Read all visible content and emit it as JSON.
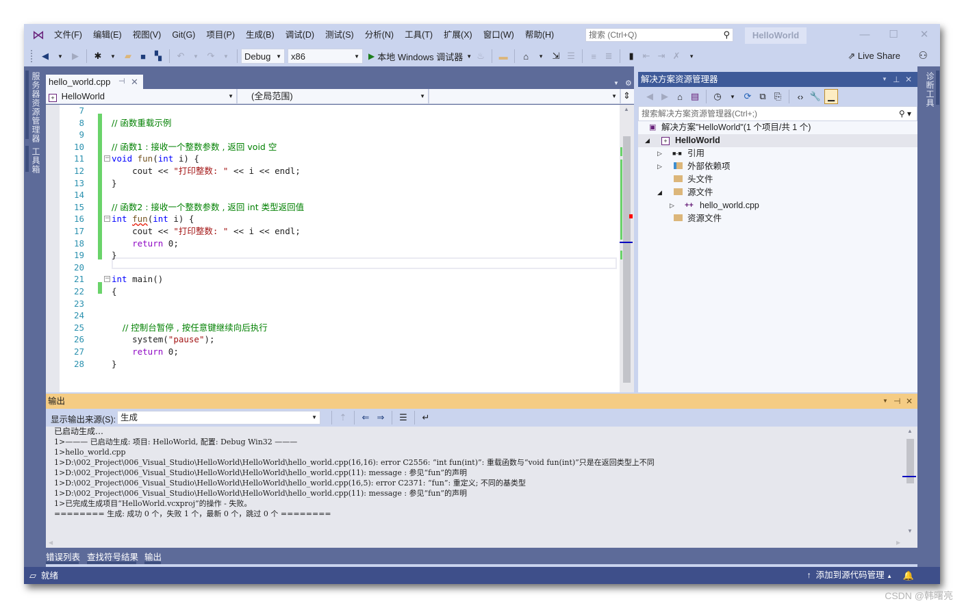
{
  "window": {
    "title_badge": "HelloWorld",
    "controls": {
      "minimize": "—",
      "maximize": "☐",
      "close": "✕"
    }
  },
  "menu": {
    "items": [
      "文件(F)",
      "编辑(E)",
      "视图(V)",
      "Git(G)",
      "项目(P)",
      "生成(B)",
      "调试(D)",
      "测试(S)",
      "分析(N)",
      "工具(T)",
      "扩展(X)",
      "窗口(W)",
      "帮助(H)"
    ]
  },
  "search": {
    "placeholder": "搜索 (Ctrl+Q)",
    "icon": "search-icon"
  },
  "toolbar": {
    "configuration": "Debug",
    "platform": "x86",
    "run_label": "本地 Windows 调试器",
    "live_share": "Live Share"
  },
  "side_tabs": {
    "left": [
      "服务器资源管理器",
      "工具箱"
    ],
    "right": [
      "诊断工具"
    ]
  },
  "editor": {
    "tab": {
      "filename": "hello_world.cpp"
    },
    "nav": {
      "project": "HelloWorld",
      "scope": "(全局范围)",
      "member": ""
    },
    "lines": [
      {
        "num": "7"
      },
      {
        "num": "8"
      },
      {
        "num": "9"
      },
      {
        "num": "10"
      },
      {
        "num": "11"
      },
      {
        "num": "12"
      },
      {
        "num": "13"
      },
      {
        "num": "14"
      },
      {
        "num": "15"
      },
      {
        "num": "16"
      },
      {
        "num": "17"
      },
      {
        "num": "18"
      },
      {
        "num": "19"
      },
      {
        "num": "20"
      },
      {
        "num": "21"
      },
      {
        "num": "22"
      },
      {
        "num": "23"
      },
      {
        "num": "24"
      },
      {
        "num": "25"
      },
      {
        "num": "26"
      },
      {
        "num": "27"
      },
      {
        "num": "28"
      }
    ],
    "code": {
      "l8_comment": "// 函数重载示例",
      "l10_comment": "// 函数1 : 接收一个整数参数 , 返回 void 空",
      "l11_kw": "void",
      "l11_fn": " fun",
      "l11_p1": "(",
      "l11_kw2": "int",
      "l11_rest": " i) {",
      "l12_cout": "    cout << ",
      "l12_str": "\"打印整数: \"",
      "l12_rest": " << i << endl;",
      "l13": "}",
      "l15_comment": "// 函数2 : 接收一个整数参数 , 返回 int 类型返回值",
      "l16_kw": "int",
      "l16_fn": "fun",
      "l16_p1": "(",
      "l16_kw2": "int",
      "l16_rest": " i) {",
      "l17_cout": "    cout << ",
      "l17_str": "\"打印整数: \"",
      "l17_rest": " << i << endl;",
      "l18_kw": "    return",
      "l18_rest": " 0;",
      "l19": "}",
      "l21_kw": "int",
      "l21_rest": " main()",
      "l22": "{",
      "l25_comment": "    // 控制台暂停 , 按任意键继续向后执行",
      "l26_fn": "    system(",
      "l26_str": "\"pause\"",
      "l26_rest": ");",
      "l27_kw": "    return",
      "l27_rest": " 0;",
      "l28": "}"
    }
  },
  "solution_explorer": {
    "title": "解决方案资源管理器",
    "search_placeholder": "搜索解决方案资源管理器(Ctrl+;)",
    "solution_label": "解决方案\"HelloWorld\"(1 个项目/共 1 个)",
    "project": "HelloWorld",
    "items": [
      {
        "label": "引用",
        "expandable": true
      },
      {
        "label": "外部依赖项",
        "expandable": true
      },
      {
        "label": "头文件",
        "expandable": false
      },
      {
        "label": "源文件",
        "expanded": true
      },
      {
        "label": "hello_world.cpp",
        "expandable": true
      },
      {
        "label": "资源文件",
        "expandable": false
      }
    ]
  },
  "output": {
    "title": "输出",
    "source_label": "显示输出来源(S):",
    "source_value": "生成",
    "lines": [
      "已启动生成…",
      "1>——— 已启动生成: 项目: HelloWorld, 配置: Debug Win32 ———",
      "1>hello_world.cpp",
      "1>D:\\002_Project\\006_Visual_Studio\\HelloWorld\\HelloWorld\\hello_world.cpp(16,16): error C2556: “int fun(int)”: 重载函数与“void fun(int)”只是在返回类型上不同",
      "1>D:\\002_Project\\006_Visual_Studio\\HelloWorld\\HelloWorld\\hello_world.cpp(11): message : 参见“fun”的声明",
      "1>D:\\002_Project\\006_Visual_Studio\\HelloWorld\\HelloWorld\\hello_world.cpp(16,5): error C2371: “fun”: 重定义; 不同的基类型",
      "1>D:\\002_Project\\006_Visual_Studio\\HelloWorld\\HelloWorld\\hello_world.cpp(11): message : 参见“fun”的声明",
      "1>已完成生成项目“HelloWorld.vcxproj”的操作 - 失败。",
      "======== 生成: 成功 0 个，失败 1 个，最新 0 个，跳过 0 个 ========"
    ]
  },
  "bottom_tabs": [
    "错误列表",
    "查找符号结果",
    "输出"
  ],
  "status": {
    "ready": "就绪",
    "source_control": "添加到源代码管理"
  },
  "watermark": "CSDN @韩曙亮",
  "colors": {
    "chrome": "#cad4ee",
    "title_bar": "#3e5a99",
    "output_header": "#f5cc84",
    "status_bar": "#3e4f8a",
    "change_mark": "#6ad36a",
    "error_mark": "#ff0000"
  }
}
